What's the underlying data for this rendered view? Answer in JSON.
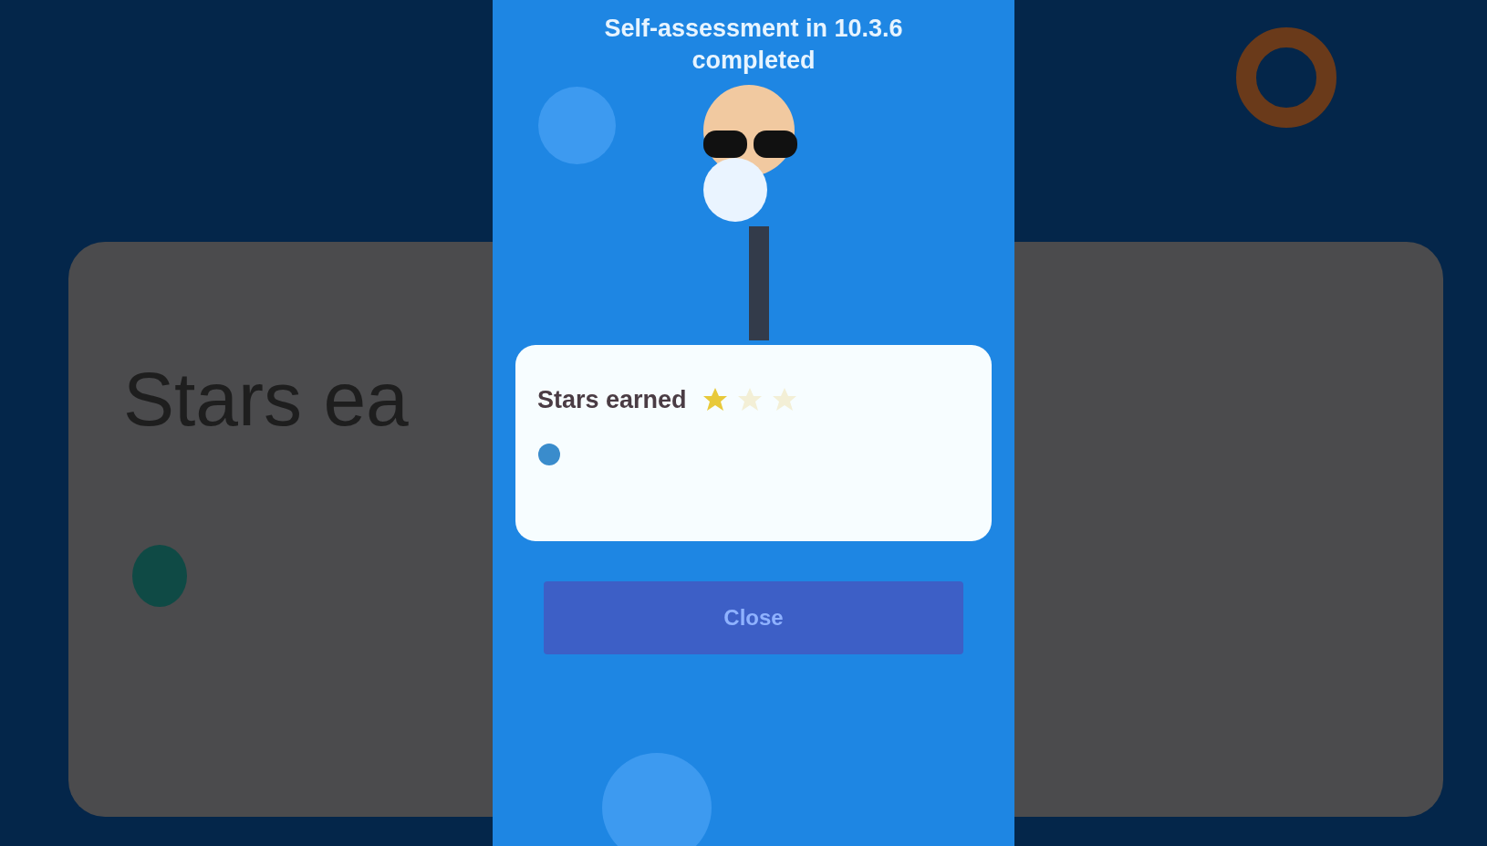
{
  "background": {
    "card_title": "Stars ea"
  },
  "dialog": {
    "title": "Self-assessment in 10.3.6 completed",
    "result": {
      "label": "Stars earned",
      "stars": 1
    },
    "button": "Close"
  }
}
